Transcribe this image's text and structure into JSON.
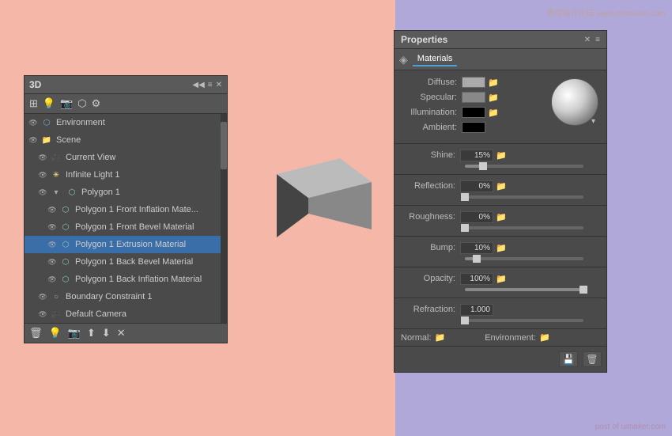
{
  "watermark_top": "思综设计论坛 www.missvuan.com",
  "watermark_bottom": "post of uimaker.com",
  "panel_3d": {
    "title": "3D",
    "collapse_icon": "◀◀",
    "close_icon": "✕",
    "menu_icon": "≡",
    "toolbar_icons": [
      "grid",
      "light",
      "camera",
      "shape",
      "settings"
    ],
    "items": [
      {
        "id": "environment",
        "label": "Environment",
        "level": 0,
        "icon": "🌐",
        "eye": true,
        "type": "group"
      },
      {
        "id": "scene",
        "label": "Scene",
        "level": 0,
        "icon": "📁",
        "eye": true,
        "type": "group"
      },
      {
        "id": "current-view",
        "label": "Current View",
        "level": 1,
        "icon": "🎥",
        "eye": true,
        "type": "item"
      },
      {
        "id": "infinite-light",
        "label": "Infinite Light 1",
        "level": 1,
        "icon": "✳",
        "eye": true,
        "type": "item"
      },
      {
        "id": "polygon1",
        "label": "Polygon 1",
        "level": 1,
        "icon": "⬡",
        "eye": true,
        "type": "group",
        "expanded": true
      },
      {
        "id": "polygon1-front-inflation",
        "label": "Polygon 1 Front Inflation Mate...",
        "level": 2,
        "icon": "⬡",
        "eye": true,
        "type": "item"
      },
      {
        "id": "polygon1-front-bevel",
        "label": "Polygon 1 Front Bevel Material",
        "level": 2,
        "icon": "⬡",
        "eye": true,
        "type": "item"
      },
      {
        "id": "polygon1-extrusion",
        "label": "Polygon 1 Extrusion Material",
        "level": 2,
        "icon": "⬡",
        "eye": true,
        "type": "item",
        "selected": true
      },
      {
        "id": "polygon1-back-bevel",
        "label": "Polygon 1 Back Bevel Material",
        "level": 2,
        "icon": "⬡",
        "eye": true,
        "type": "item"
      },
      {
        "id": "polygon1-back-inflation",
        "label": "Polygon 1 Back Inflation Material",
        "level": 2,
        "icon": "⬡",
        "eye": true,
        "type": "item"
      },
      {
        "id": "boundary",
        "label": "Boundary Constraint 1",
        "level": 1,
        "icon": "○",
        "eye": true,
        "type": "item"
      },
      {
        "id": "default-camera",
        "label": "Default Camera",
        "level": 1,
        "icon": "🎥",
        "eye": true,
        "type": "item"
      }
    ],
    "footer_icons": [
      "trash",
      "light",
      "camera",
      "move-up",
      "move-down",
      "delete"
    ]
  },
  "panel_properties": {
    "title": "Properties",
    "close_icon": "✕",
    "menu_icon": "≡",
    "tab": "Materials",
    "tab_icon": "◈",
    "material": {
      "diffuse_label": "Diffuse:",
      "diffuse_color": "#aaaaaa",
      "specular_label": "Specular:",
      "specular_color": "#888888",
      "illumination_label": "Illumination:",
      "illumination_color": "#000000",
      "ambient_label": "Ambient:",
      "ambient_color": "#000000"
    },
    "properties": [
      {
        "id": "shine",
        "label": "Shine:",
        "value": "15%",
        "slider_pct": 15
      },
      {
        "id": "reflection",
        "label": "Reflection:",
        "value": "0%",
        "slider_pct": 0
      },
      {
        "id": "roughness",
        "label": "Roughness:",
        "value": "0%",
        "slider_pct": 0
      },
      {
        "id": "bump",
        "label": "Bump:",
        "value": "10%",
        "slider_pct": 10
      },
      {
        "id": "opacity",
        "label": "Opacity:",
        "value": "100%",
        "slider_pct": 100
      },
      {
        "id": "refraction",
        "label": "Refraction:",
        "value": "1.000",
        "slider_pct": 0
      }
    ],
    "normal_label": "Normal:",
    "environment_label": "Environment:",
    "footer_icons": [
      "save",
      "delete"
    ]
  }
}
